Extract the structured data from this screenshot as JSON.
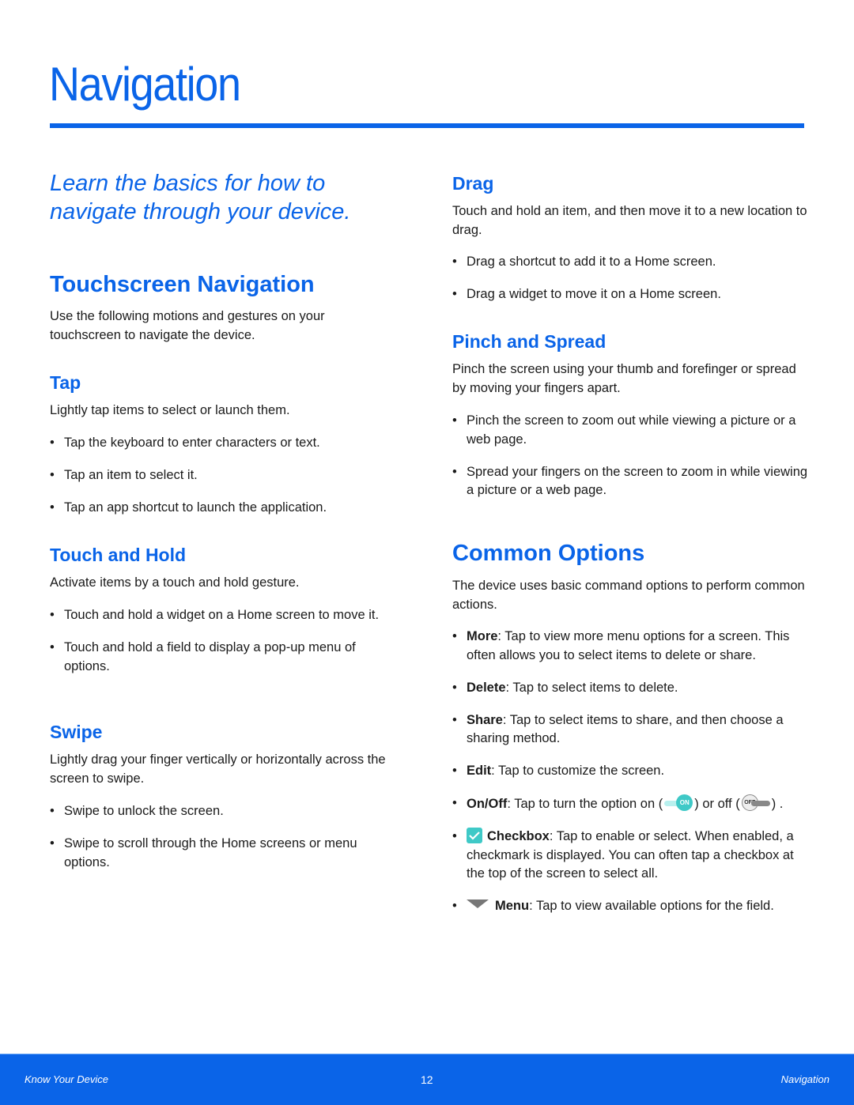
{
  "page": {
    "title": "Navigation",
    "accent_color": "#0a64e8"
  },
  "left": {
    "intro": "Learn the basics for how to navigate through your device.",
    "touchscreen": {
      "heading": "Touchscreen Navigation",
      "body": "Use the following motions and gestures on your touchscreen to navigate the device."
    },
    "tap": {
      "heading": "Tap",
      "body": "Lightly tap items to select or launch them.",
      "bullets": [
        "Tap the keyboard to enter characters or text.",
        "Tap an item to select it.",
        "Tap an app shortcut to launch the application."
      ]
    },
    "touch_hold": {
      "heading": "Touch and Hold",
      "body": "Activate items by a touch and hold gesture.",
      "bullets": [
        "Touch and hold a widget on a Home screen to move it.",
        "Touch and hold a field to display a pop-up menu of options."
      ]
    },
    "swipe": {
      "heading": "Swipe",
      "body": "Lightly drag your finger vertically or horizontally across the screen to swipe.",
      "bullets": [
        "Swipe to unlock the screen.",
        "Swipe to scroll through the Home screens or menu options."
      ]
    }
  },
  "right": {
    "drag": {
      "heading": "Drag",
      "body": "Touch and hold an item, and then move it to a new location to drag.",
      "bullets": [
        "Drag a shortcut to add it to a Home screen.",
        "Drag a widget to move it on a Home screen."
      ]
    },
    "pinch": {
      "heading": "Pinch and Spread",
      "body": "Pinch the screen using your thumb and forefinger or spread by moving your fingers apart.",
      "bullets": [
        "Pinch the screen to zoom out while viewing a picture or a web page.",
        "Spread your fingers on the screen to zoom in while viewing a picture or a web page."
      ]
    },
    "common": {
      "heading": "Common Options",
      "body": "The device uses basic command options to perform common actions.",
      "more_label": "More",
      "more_text": ": Tap to view more menu options for a screen. This often allows you to select items to delete or share.",
      "delete_label": "Delete",
      "delete_text": ": Tap to select items to delete.",
      "share_label": "Share",
      "share_text": ": Tap to select items to share, and then choose a sharing method.",
      "edit_label": "Edit",
      "edit_text": ": Tap to customize the screen.",
      "onoff_label": "On/Off",
      "onoff_text1": ": Tap to turn the option on (",
      "onoff_text2": ") or off (",
      "onoff_text3": ") .",
      "on_badge": "ON",
      "off_badge": "OFF",
      "checkbox_label": "Checkbox",
      "checkbox_text": ": Tap to enable or select. When enabled, a checkmark is displayed. You can often tap a checkbox at the top of the screen to select all.",
      "menu_label": "Menu",
      "menu_text": ": Tap to view available options for the field."
    }
  },
  "footer": {
    "section": "Know Your Device",
    "page_number": "12",
    "chapter": "Navigation"
  }
}
